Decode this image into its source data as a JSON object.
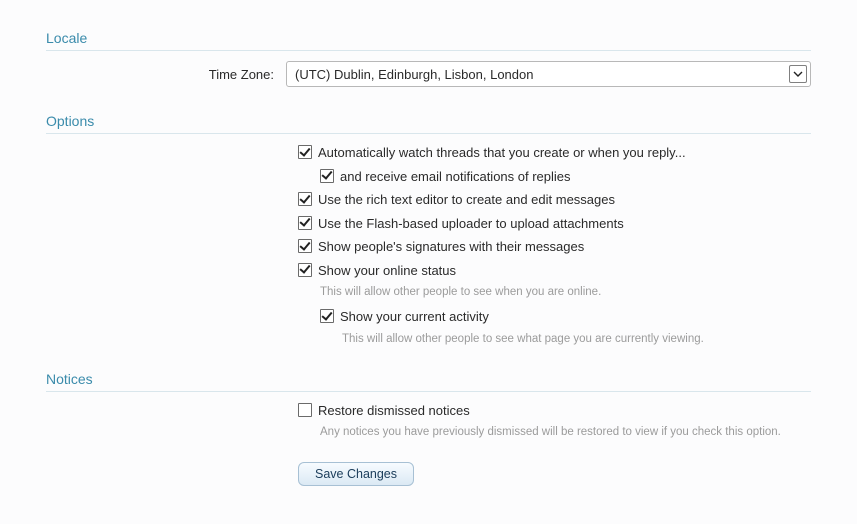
{
  "sections": {
    "locale": {
      "title": "Locale",
      "timezone_label": "Time Zone:",
      "timezone_value": "(UTC) Dublin, Edinburgh, Lisbon, London"
    },
    "options": {
      "title": "Options",
      "auto_watch": {
        "checked": true,
        "label": "Automatically watch threads that you create or when you reply..."
      },
      "email_replies": {
        "checked": true,
        "label": "and receive email notifications of replies"
      },
      "rich_text": {
        "checked": true,
        "label": "Use the rich text editor to create and edit messages"
      },
      "flash_uploader": {
        "checked": true,
        "label": "Use the Flash-based uploader to upload attachments"
      },
      "signatures": {
        "checked": true,
        "label": "Show people's signatures with their messages"
      },
      "online_status": {
        "checked": true,
        "label": "Show your online status",
        "hint": "This will allow other people to see when you are online."
      },
      "current_activity": {
        "checked": true,
        "label": "Show your current activity",
        "hint": "This will allow other people to see what page you are currently viewing."
      }
    },
    "notices": {
      "title": "Notices",
      "restore": {
        "checked": false,
        "label": "Restore dismissed notices",
        "hint": "Any notices you have previously dismissed will be restored to view if you check this option."
      }
    }
  },
  "actions": {
    "save_label": "Save Changes"
  }
}
